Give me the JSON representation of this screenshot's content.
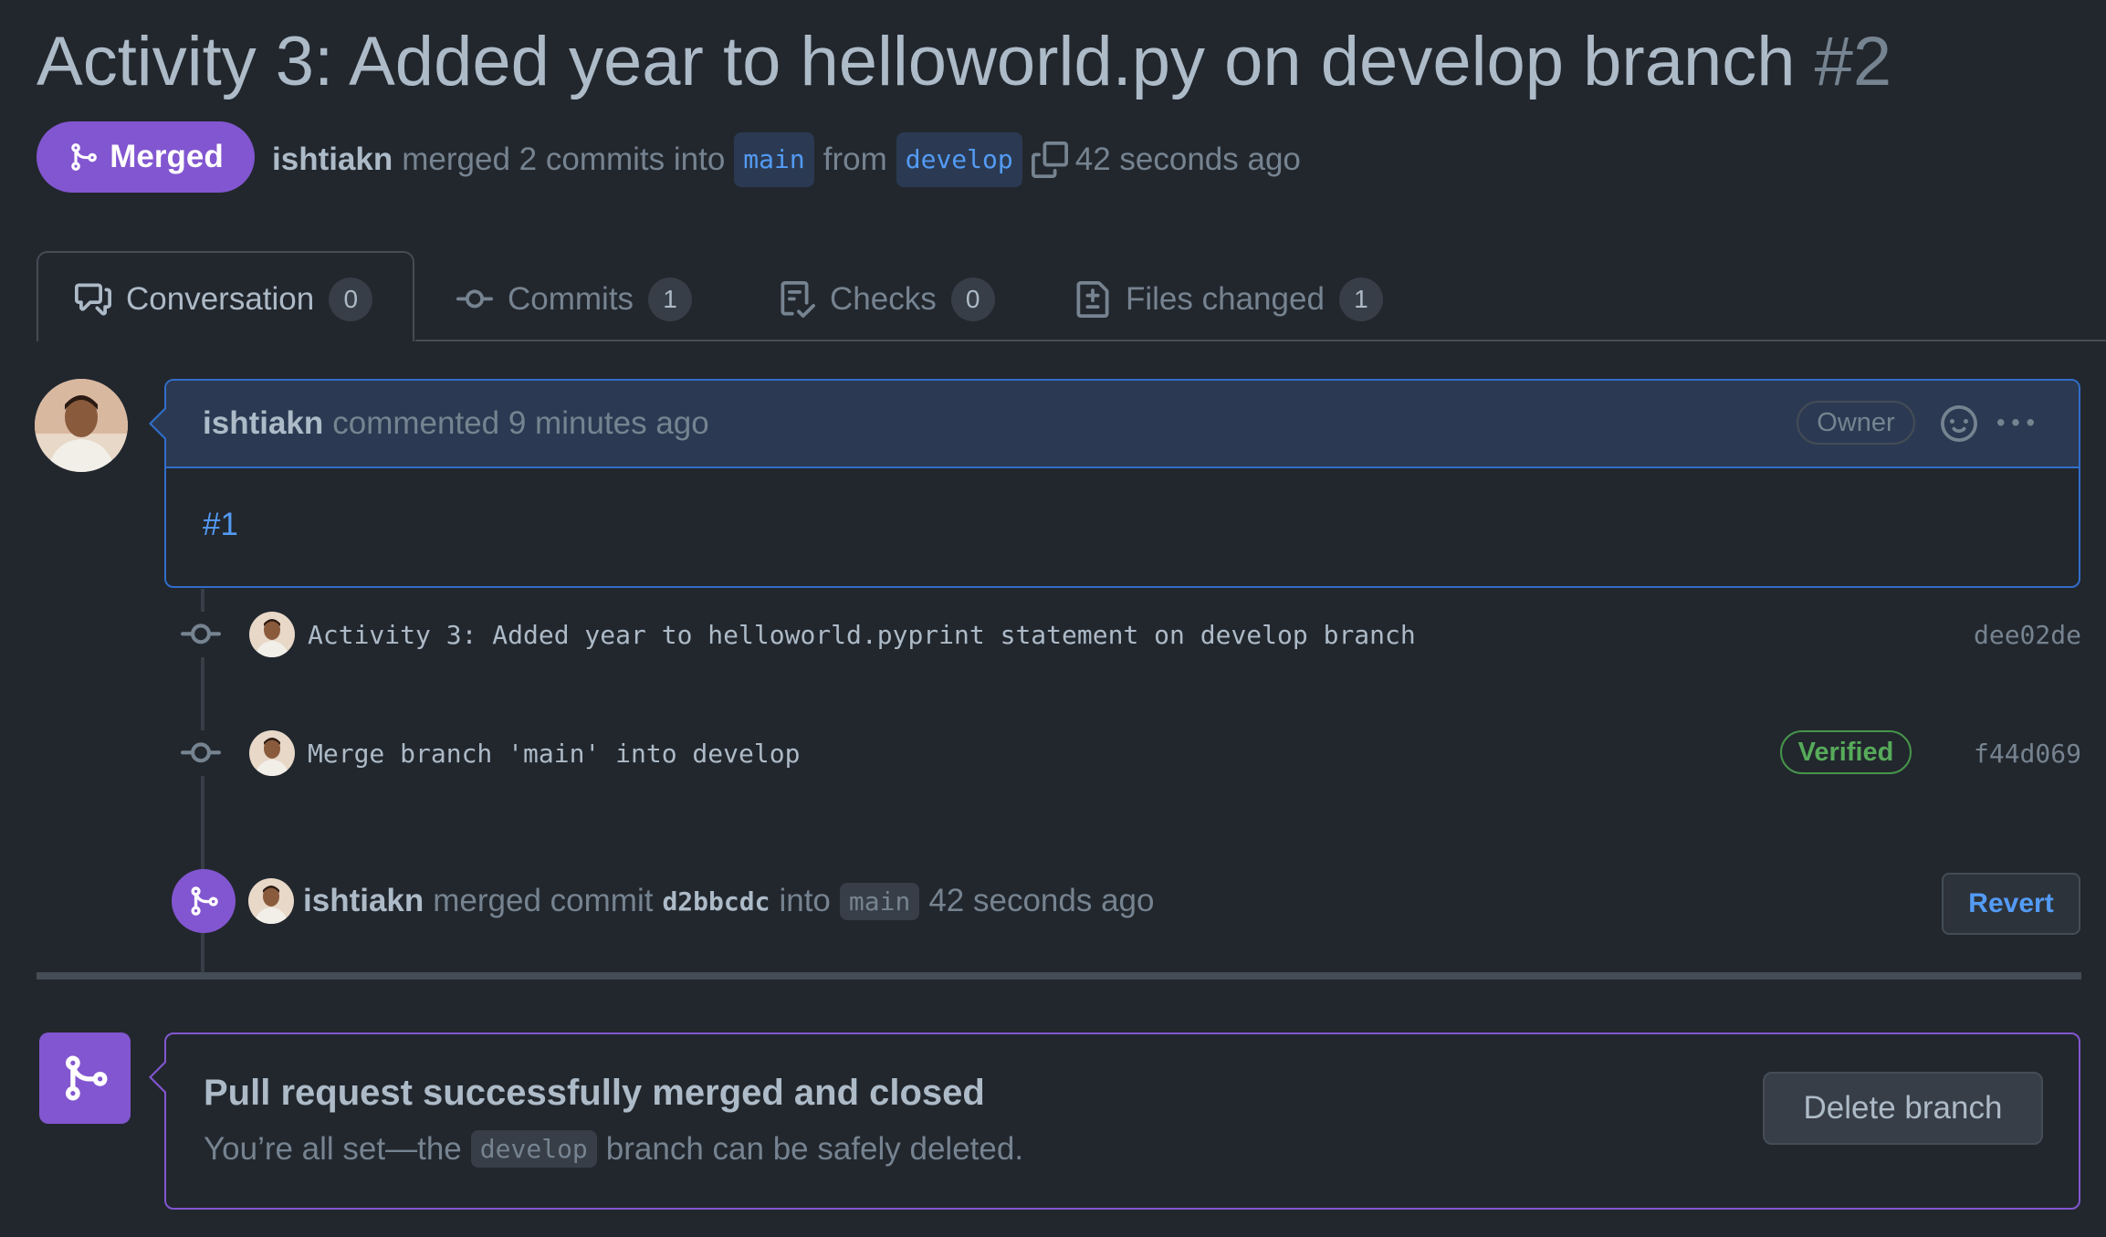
{
  "header": {
    "title": "Activity 3: Added year to helloworld.py on develop branch",
    "number": "#2",
    "status_label": "Merged",
    "author": "ishtiakn",
    "merged_text": "merged 2 commits into",
    "base_branch": "main",
    "from_text": "from",
    "head_branch": "develop",
    "time": "42 seconds ago"
  },
  "tabs": [
    {
      "label": "Conversation",
      "count": "0"
    },
    {
      "label": "Commits",
      "count": "1"
    },
    {
      "label": "Checks",
      "count": "0"
    },
    {
      "label": "Files changed",
      "count": "1"
    }
  ],
  "comment": {
    "author": "ishtiakn",
    "action": "commented 9 minutes ago",
    "role_badge": "Owner",
    "body": "#1"
  },
  "commits": [
    {
      "message": "Activity 3: Added year to helloworld.pyprint statement on develop branch",
      "sha": "dee02de",
      "badge": ""
    },
    {
      "message": "Merge branch 'main' into develop",
      "sha": "f44d069",
      "badge": "Verified"
    }
  ],
  "merge_event": {
    "author": "ishtiakn",
    "text1": "merged commit",
    "sha": "d2bbcdc",
    "text2": "into",
    "branch": "main",
    "time": "42 seconds ago",
    "revert_label": "Revert"
  },
  "merged_box": {
    "title": "Pull request successfully merged and closed",
    "sub_before": "You’re all set—the",
    "branch": "develop",
    "sub_after": "branch can be safely deleted.",
    "delete_label": "Delete branch"
  },
  "colors": {
    "background": "#22272e",
    "merged_purple": "#8256d0",
    "link_blue": "#539bf5",
    "verified_green": "#57ab5a"
  }
}
